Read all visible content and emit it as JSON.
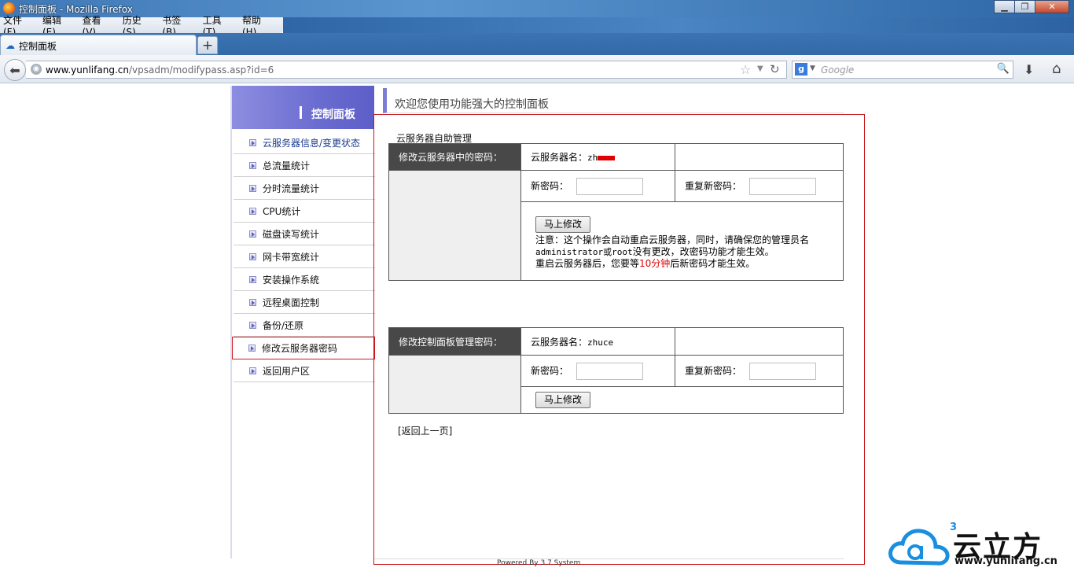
{
  "window": {
    "title": "控制面板 - Mozilla Firefox",
    "controls": {
      "minimize": "▁",
      "maximize": "❐",
      "close": "✕"
    }
  },
  "menu": [
    "文件(F)",
    "编辑(E)",
    "查看(V)",
    "历史(S)",
    "书签(B)",
    "工具(T)",
    "帮助(H)"
  ],
  "tabs": [
    {
      "label": "控制面板",
      "icon": "cloud-icon"
    }
  ],
  "newtab_label": "+",
  "url": {
    "host": "www.yunlifang.cn",
    "path": "/vpsadm/modifypass.asp?id=6"
  },
  "search": {
    "engine": "g",
    "placeholder": "Google"
  },
  "sidebar": {
    "header": "控制面板",
    "items": [
      {
        "label": "云服务器信息/变更状态"
      },
      {
        "label": "总流量统计"
      },
      {
        "label": "分时流量统计"
      },
      {
        "label": "CPU统计"
      },
      {
        "label": "磁盘读写统计"
      },
      {
        "label": "网卡带宽统计"
      },
      {
        "label": "安装操作系统"
      },
      {
        "label": "远程桌面控制"
      },
      {
        "label": "备份/还原"
      },
      {
        "label": "修改云服务器密码"
      },
      {
        "label": "返回用户区"
      }
    ]
  },
  "welcome": "欢迎您使用功能强大的控制面板",
  "section_title": "云服务器自助管理",
  "form1": {
    "heading": "修改云服务器中的密码：",
    "server_label": "云服务器名：",
    "server_value": "zh",
    "newpass_label": "新密码：",
    "repeat_label": "重复新密码：",
    "submit": "马上修改",
    "note_line1": "注意：这个操作会自动重启云服务器，同时，请确保您的管理员名",
    "note_line2_mono": "administrator或root",
    "note_line2_rest": "没有更改，改密码功能才能生效。",
    "note_line3_a": "重启云服务器后，您要等",
    "note_line3_red": "10分钟",
    "note_line3_b": "后新密码才能生效。"
  },
  "form2": {
    "heading": "修改控制面板管理密码：",
    "server_label": "云服务器名：",
    "server_value": "zhuce",
    "newpass_label": "新密码：",
    "repeat_label": "重复新密码：",
    "submit": "马上修改"
  },
  "back_link": "[返回上一页]",
  "powered": "Powered By 3.7 System",
  "logo": {
    "superscript": "3",
    "name": "云立方",
    "url": "www.yunlifang.cn"
  },
  "colors": {
    "accent": "#6b6cd0",
    "highlight": "#c8141a",
    "form_header": "#484848"
  }
}
